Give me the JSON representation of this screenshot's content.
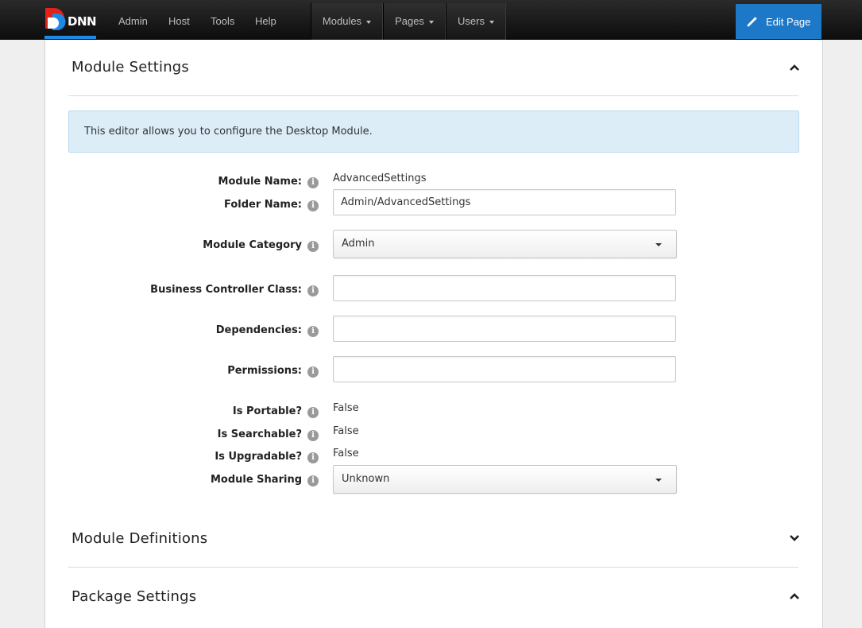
{
  "topbar": {
    "logo_text": "DNN",
    "nav": [
      "Admin",
      "Host",
      "Tools",
      "Help"
    ],
    "groups": [
      "Modules",
      "Pages",
      "Users"
    ],
    "edit_page_label": "Edit Page",
    "colors": {
      "accent": "#1d78c8",
      "logo_red": "#e2231a",
      "logo_blue": "#1e88e5"
    }
  },
  "module_settings": {
    "title": "Module Settings",
    "info": "This editor allows you to configure the Desktop Module.",
    "fields": {
      "module_name_label": "Module Name:",
      "module_name_value": "AdvancedSettings",
      "folder_name_label": "Folder Name:",
      "folder_name_value": "Admin/AdvancedSettings",
      "module_category_label": "Module Category",
      "module_category_value": "Admin",
      "business_controller_label": "Business Controller Class:",
      "business_controller_value": "",
      "dependencies_label": "Dependencies:",
      "dependencies_value": "",
      "permissions_label": "Permissions:",
      "permissions_value": "",
      "is_portable_label": "Is Portable?",
      "is_portable_value": "False",
      "is_searchable_label": "Is Searchable?",
      "is_searchable_value": "False",
      "is_upgradable_label": "Is Upgradable?",
      "is_upgradable_value": "False",
      "module_sharing_label": "Module Sharing",
      "module_sharing_value": "Unknown"
    },
    "help_icon_glyph": "i"
  },
  "module_definitions": {
    "title": "Module Definitions"
  },
  "package_settings": {
    "title": "Package Settings"
  }
}
